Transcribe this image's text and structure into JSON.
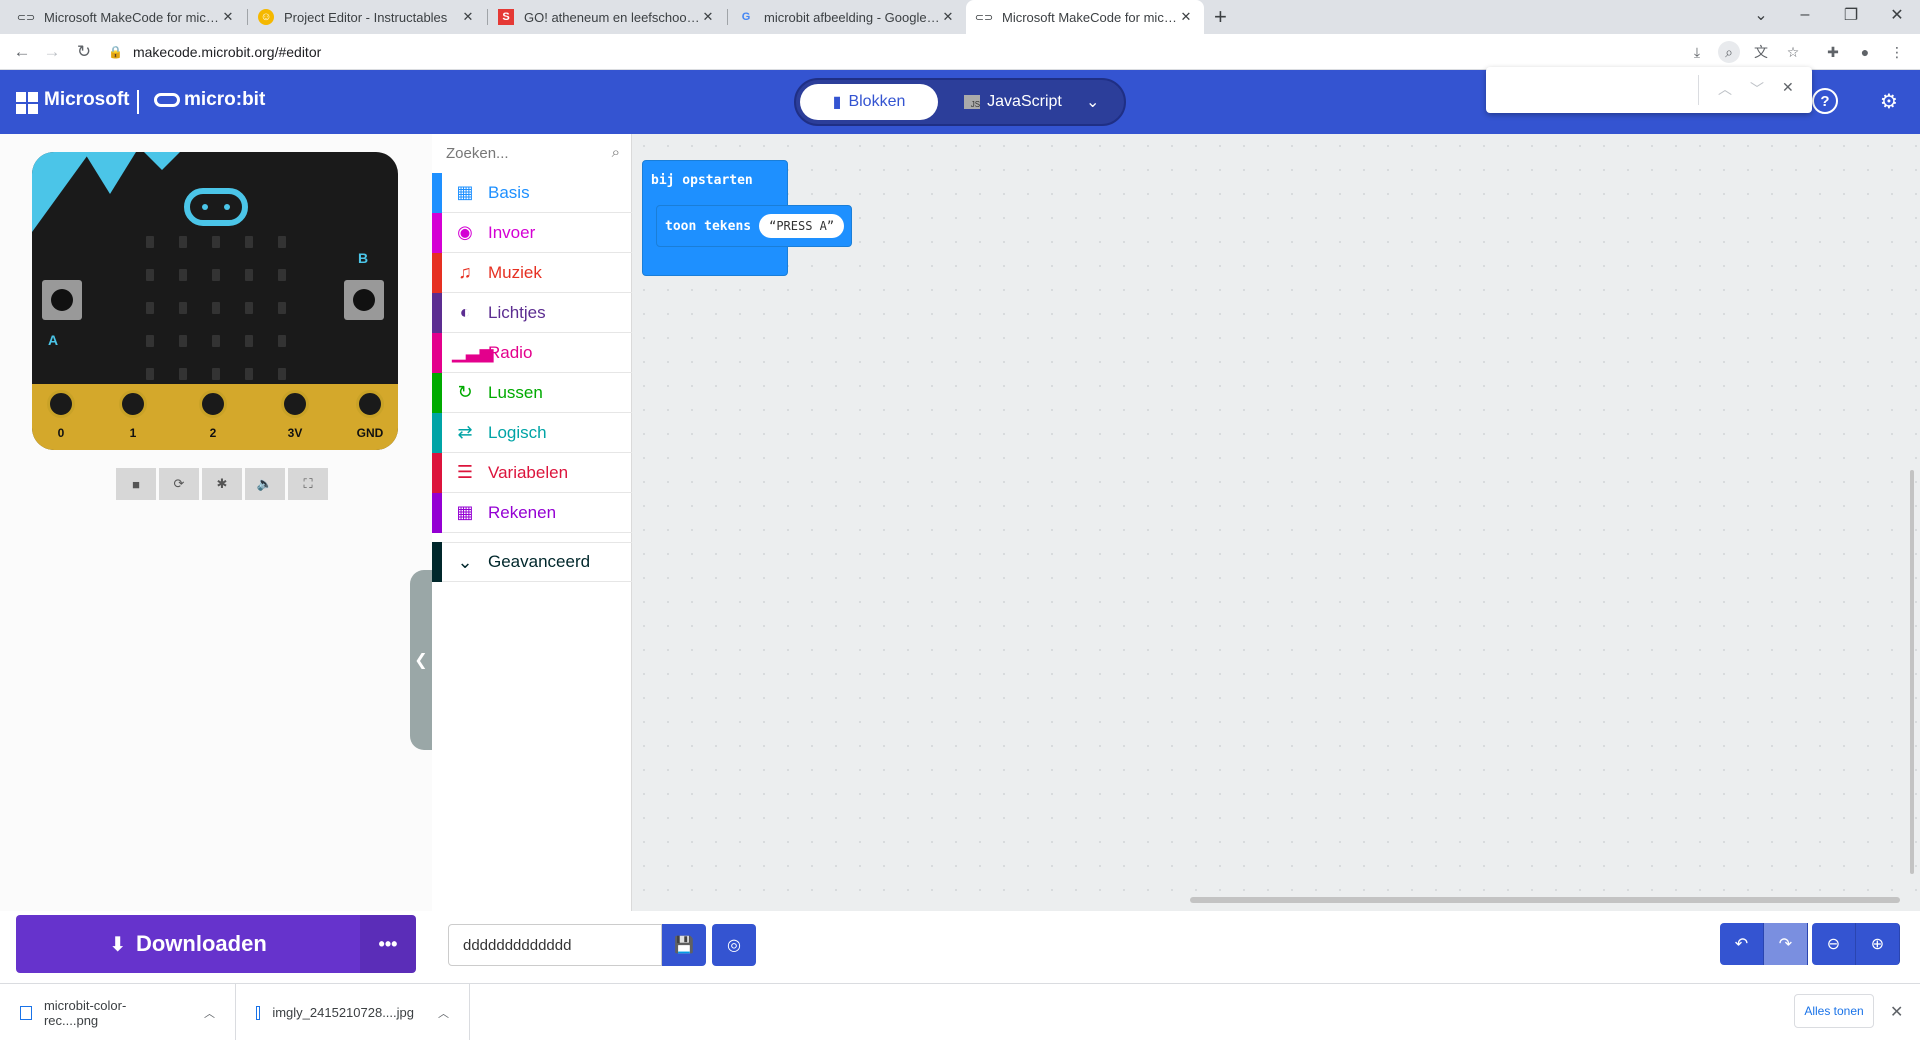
{
  "browser": {
    "tabs": [
      {
        "title": "Microsoft MakeCode for micro:bit",
        "favicon": "makecode-icon"
      },
      {
        "title": "Project Editor - Instructables",
        "favicon": "instructables-icon"
      },
      {
        "title": "GO! atheneum en leefschool De",
        "favicon": "s-icon"
      },
      {
        "title": "microbit afbeelding - Google Zo",
        "favicon": "google-icon"
      },
      {
        "title": "Microsoft MakeCode for micro:bit",
        "favicon": "makecode-icon"
      }
    ],
    "url": "makecode.microbit.org/#editor"
  },
  "header": {
    "brand": "Microsoft",
    "product": "micro:bit",
    "toggle": {
      "blocks_label": "Blokken",
      "js_label": "JavaScript"
    },
    "accent": "#3454d1"
  },
  "simulator": {
    "pins": [
      "0",
      "1",
      "2",
      "3V",
      "GND"
    ],
    "button_a": "A",
    "button_b": "B"
  },
  "toolbox": {
    "search_placeholder": "Zoeken...",
    "categories": [
      {
        "label": "Basis",
        "color": "#1e90ff",
        "icon": "grid-icon"
      },
      {
        "label": "Invoer",
        "color": "#d400d4",
        "icon": "target-icon"
      },
      {
        "label": "Muziek",
        "color": "#e63022",
        "icon": "headphones-icon"
      },
      {
        "label": "Lichtjes",
        "color": "#5c2d91",
        "icon": "toggle-icon"
      },
      {
        "label": "Radio",
        "color": "#e3008c",
        "icon": "signal-icon"
      },
      {
        "label": "Lussen",
        "color": "#00aa00",
        "icon": "refresh-icon"
      },
      {
        "label": "Logisch",
        "color": "#00a4a6",
        "icon": "shuffle-icon"
      },
      {
        "label": "Variabelen",
        "color": "#dc143c",
        "icon": "lines-icon"
      },
      {
        "label": "Rekenen",
        "color": "#9400d3",
        "icon": "calculator-icon"
      },
      {
        "label": "Geavanceerd",
        "color": "#00272b",
        "icon": "chevron-down-icon"
      }
    ]
  },
  "blocks": {
    "hat_label": "bij opstarten",
    "stmt_label": "toon tekens",
    "string_value": "PRESS A"
  },
  "bottom": {
    "download_label": "Downloaden",
    "more_label": "•••",
    "project_name": "ddddddddddddd"
  },
  "downloads": {
    "items": [
      "microbit-color-rec....png",
      "imgly_2415210728....jpg"
    ],
    "show_all": "Alles tonen"
  }
}
